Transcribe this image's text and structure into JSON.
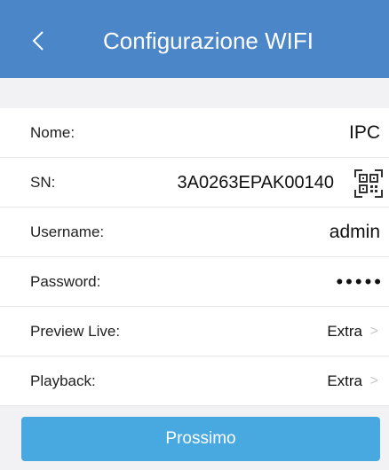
{
  "header": {
    "title": "Configurazione WIFI",
    "back_icon": "chevron-left-icon",
    "background": "#4a86c8"
  },
  "form": {
    "rows": [
      {
        "label": "Nome:",
        "value": "IPC"
      },
      {
        "label": "SN:",
        "value": "3A0263EPAK00140",
        "icon": "qr-code-icon"
      },
      {
        "label": "Username:",
        "value": "admin"
      },
      {
        "label": "Password:",
        "value": "•••••"
      },
      {
        "label": "Preview Live:",
        "value": "Extra"
      },
      {
        "label": "Playback:",
        "value": "Extra"
      }
    ]
  },
  "next_button": {
    "label": "Prossimo",
    "color": "#48a8e0"
  }
}
